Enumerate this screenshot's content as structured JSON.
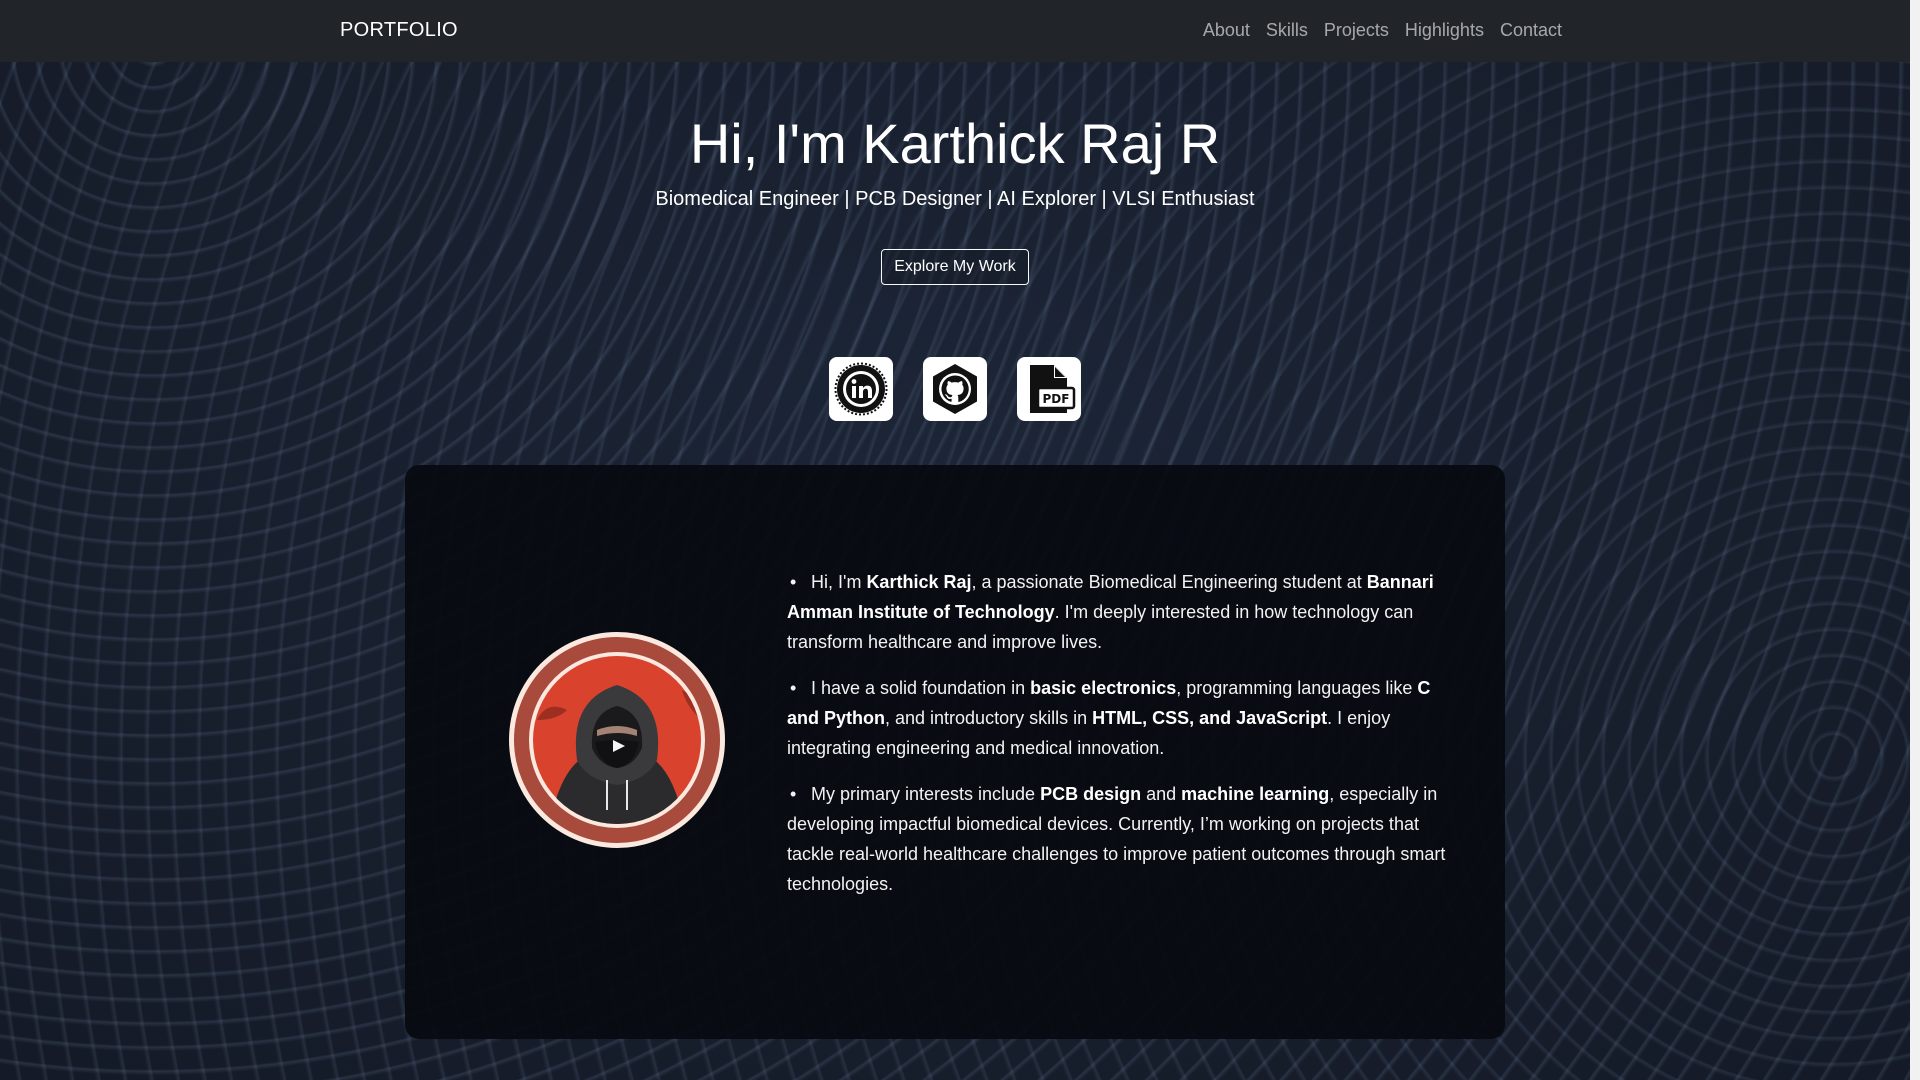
{
  "nav": {
    "brand": "PORTFOLIO",
    "links": [
      "About",
      "Skills",
      "Projects",
      "Highlights",
      "Contact"
    ]
  },
  "hero": {
    "title": "Hi, I'm Karthick Raj R",
    "subtitle": "Biomedical Engineer | PCB Designer | AI Explorer | VLSI Enthusiast",
    "cta": "Explore My Work"
  },
  "socials": [
    {
      "icon": "linkedin-icon"
    },
    {
      "icon": "github-icon"
    },
    {
      "icon": "pdf-icon"
    }
  ],
  "about": {
    "p1": {
      "t1": "Hi, I'm ",
      "b1": "Karthick Raj",
      "t2": ", a passionate Biomedical Engineering student at ",
      "b2": "Bannari Amman Institute of Technology",
      "t3": ". I'm deeply interested in how technology can transform healthcare and improve lives."
    },
    "p2": {
      "t1": "I have a solid foundation in ",
      "b1": "basic electronics",
      "t2": ", programming languages like ",
      "b2": "C and Python",
      "t3": ", and introductory skills in ",
      "b3": "HTML, CSS, and JavaScript",
      "t4": ". I enjoy integrating engineering and medical innovation."
    },
    "p3": {
      "t1": "My primary interests include ",
      "b1": "PCB design",
      "t2": " and ",
      "b2": "machine learning",
      "t3": ", especially in developing impactful biomedical devices. Currently, I’m working on projects that tackle real-world healthcare challenges to improve patient outcomes through smart technologies."
    }
  },
  "colors": {
    "navbar": "#212529",
    "avatar_ring": "#a84a3c",
    "avatar_bg": "#d9432e"
  }
}
